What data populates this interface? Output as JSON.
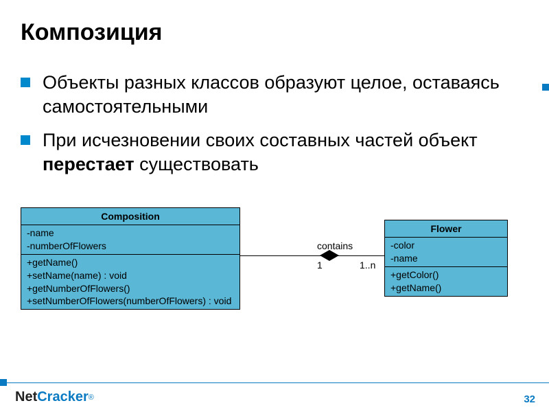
{
  "title": "Композиция",
  "bullets": [
    {
      "text": "Объекты разных классов образуют целое, оставаясь самостоятельными"
    },
    {
      "prefix": "При исчезновении своих составных частей объект ",
      "bold": "перестает",
      "suffix": " существовать"
    }
  ],
  "uml": {
    "composition": {
      "name": "Composition",
      "attributes": [
        "-name",
        "-numberOfFlowers"
      ],
      "methods": [
        "+getName()",
        "+setName(name) : void",
        "+getNumberOfFlowers()",
        "+setNumberOfFlowers(numberOfFlowers) : void"
      ]
    },
    "flower": {
      "name": "Flower",
      "attributes": [
        "-color",
        "-name"
      ],
      "methods": [
        "+getColor()",
        "+getName()"
      ]
    },
    "association": {
      "label": "contains",
      "mult_left": "1",
      "mult_right": "1..n"
    }
  },
  "footer": {
    "logo_left": "Net",
    "logo_right": "Cracker",
    "reg": "®",
    "page": "32"
  }
}
